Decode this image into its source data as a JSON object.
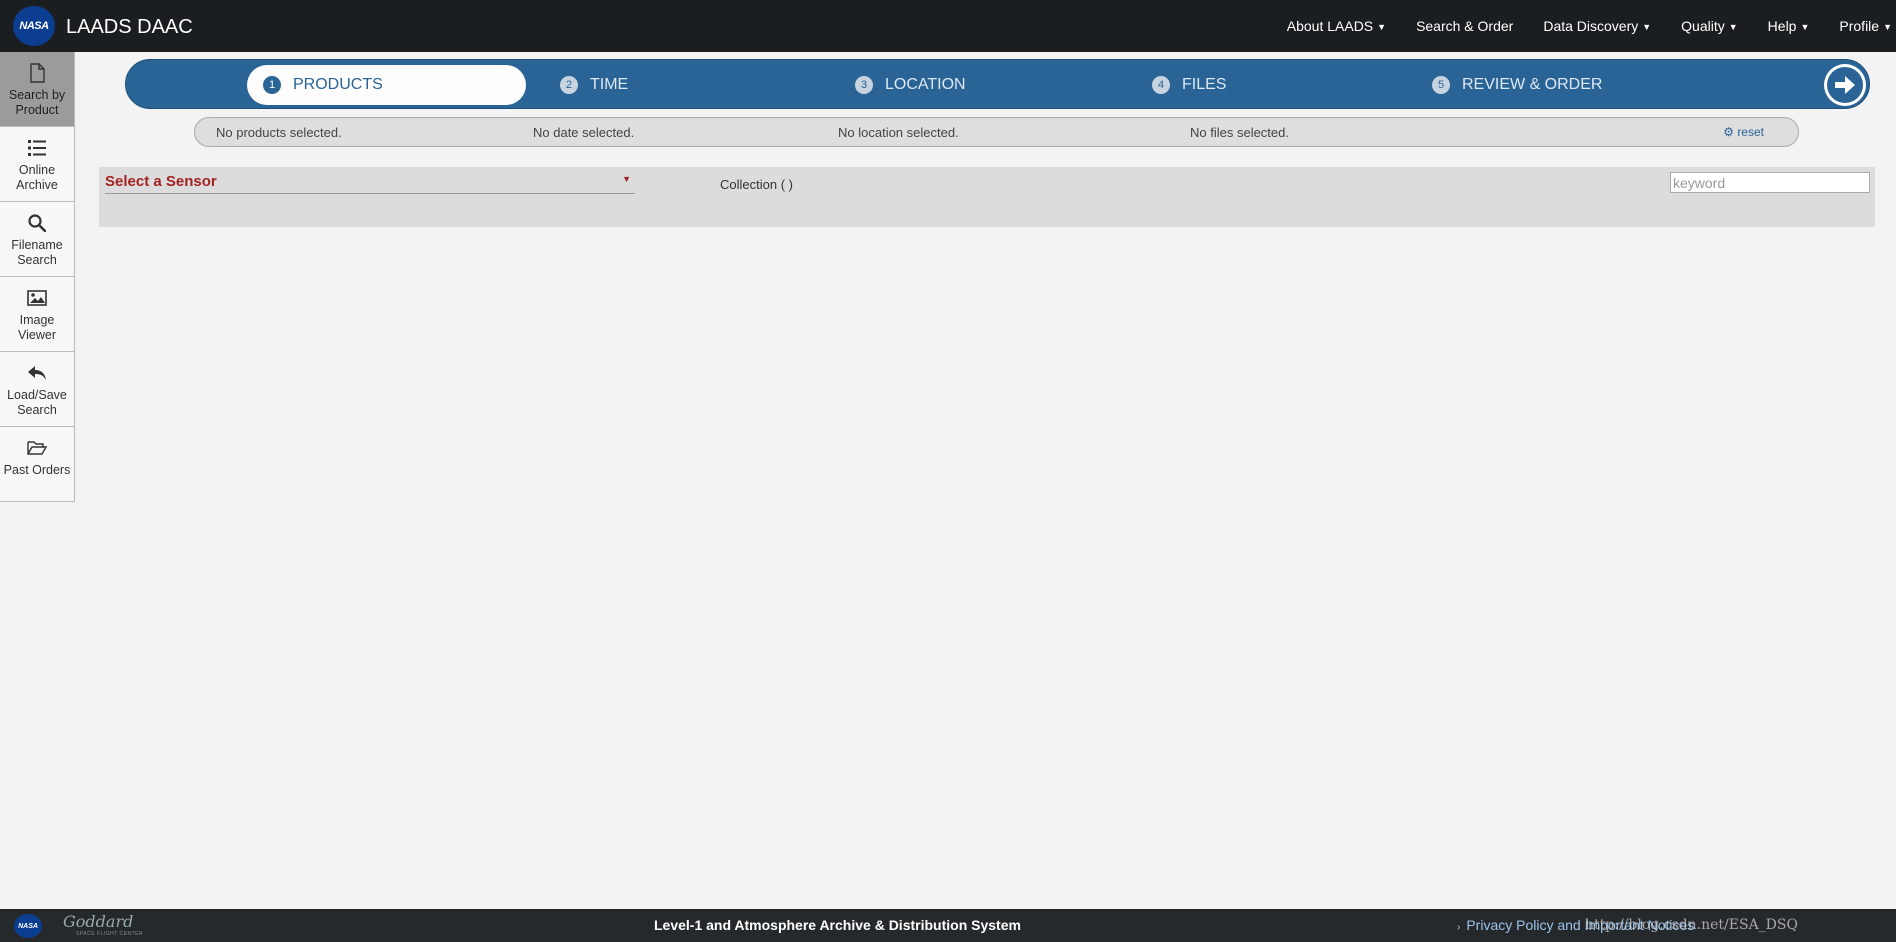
{
  "navbar": {
    "brand": "LAADS DAAC",
    "logo_text": "NASA",
    "menu": [
      {
        "label": "About LAADS",
        "dropdown": true
      },
      {
        "label": "Search & Order",
        "dropdown": false
      },
      {
        "label": "Data Discovery",
        "dropdown": true
      },
      {
        "label": "Quality",
        "dropdown": true
      },
      {
        "label": "Help",
        "dropdown": true
      },
      {
        "label": "Profile",
        "dropdown": true
      }
    ]
  },
  "sidebar": {
    "items": [
      {
        "label": "Search by Product",
        "icon": "file-icon",
        "active": true
      },
      {
        "label": "Online Archive",
        "icon": "list-icon",
        "active": false
      },
      {
        "label": "Filename Search",
        "icon": "search-icon",
        "active": false
      },
      {
        "label": "Image Viewer",
        "icon": "image-icon",
        "active": false
      },
      {
        "label": "Load/Save Search",
        "icon": "reply-icon",
        "active": false
      },
      {
        "label": "Past Orders",
        "icon": "folder-open-icon",
        "active": false
      }
    ]
  },
  "steps": [
    {
      "num": "1",
      "label": "PRODUCTS",
      "active": true
    },
    {
      "num": "2",
      "label": "TIME",
      "active": false
    },
    {
      "num": "3",
      "label": "LOCATION",
      "active": false
    },
    {
      "num": "4",
      "label": "FILES",
      "active": false
    },
    {
      "num": "5",
      "label": "REVIEW & ORDER",
      "active": false
    }
  ],
  "summary": {
    "products": "No products selected.",
    "date": "No date selected.",
    "location": "No location selected.",
    "files": "No files selected.",
    "reset": "reset"
  },
  "panel": {
    "sensor_label": "Select a Sensor",
    "collection": "Collection ( )",
    "keyword_placeholder": "keyword"
  },
  "footer": {
    "logo_text": "NASA",
    "goddard": "Goddard",
    "goddard_sub": "SPACE FLIGHT CENTER",
    "title": "Level-1 and Atmosphere Archive & Distribution System",
    "privacy": "Privacy Policy and Important Notices",
    "watermark": "http://blog.csdn.net/ESA_DSQ"
  },
  "colors": {
    "navbar_bg": "#1b1e21",
    "stepbar_bg": "#2a6496",
    "sensor_red": "#a42222",
    "link_blue": "#9cc3ea"
  }
}
